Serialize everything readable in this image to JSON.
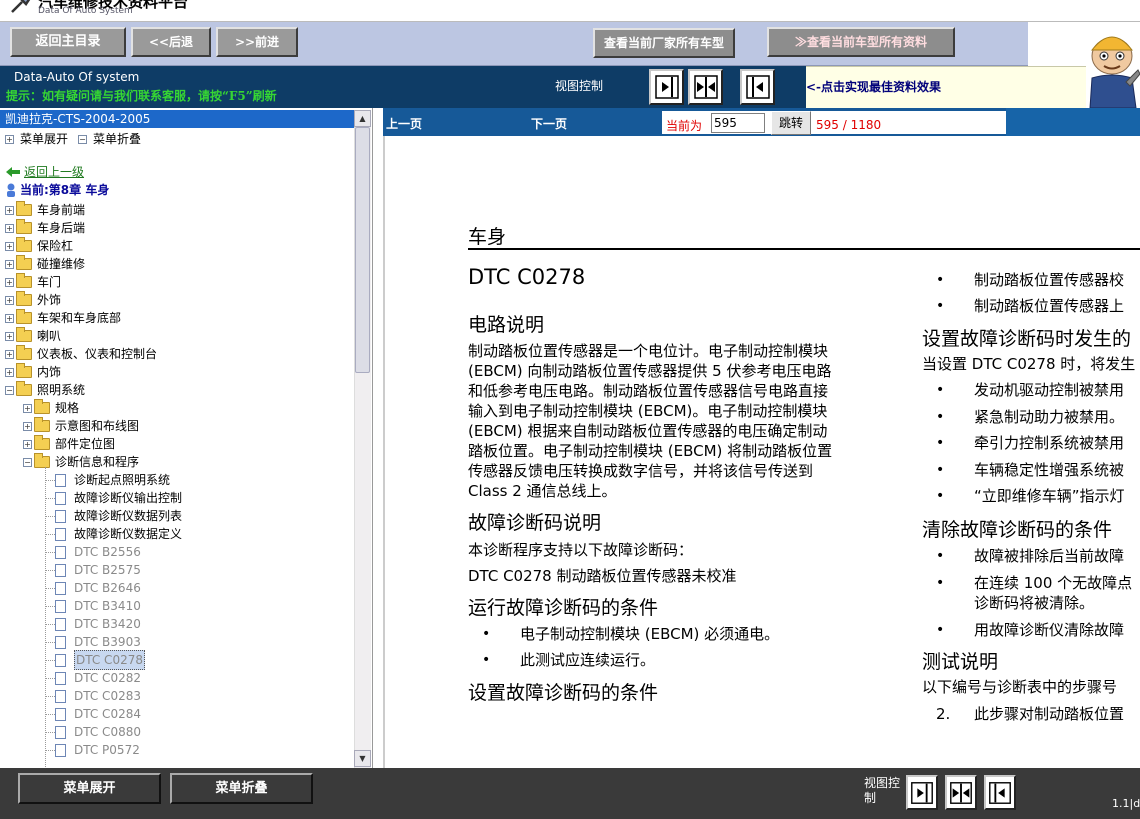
{
  "app": {
    "title": "汽车维修技术资料平台",
    "subtitle": "Data Of Auto System"
  },
  "toolbar": {
    "home": "返回主目录",
    "back": "<<后退",
    "forward": ">>前进",
    "all_makes": "查看当前厂家所有车型",
    "all_data": "≫查看当前车型所有资料"
  },
  "status_row": {
    "system_name": "Data-Auto Of system",
    "notice": "提示：如有疑问请与我们联系客服，请按“F5”刷新",
    "view_label": "视图控制",
    "hint": "<-点击实现最佳资料效果"
  },
  "tree": {
    "header": "凯迪拉克-CTS-2004-2005",
    "expand_all": "菜单展开",
    "collapse_all": "菜单折叠",
    "back_up": "返回上一级",
    "current": "当前:第8章  车身",
    "folders": [
      {
        "label": "车身前端"
      },
      {
        "label": "车身后端"
      },
      {
        "label": "保险杠"
      },
      {
        "label": "碰撞维修"
      },
      {
        "label": "车门"
      },
      {
        "label": "外饰"
      },
      {
        "label": "车架和车身底部"
      },
      {
        "label": "喇叭"
      },
      {
        "label": "仪表板、仪表和控制台"
      },
      {
        "label": "内饰"
      },
      {
        "label": "照明系统"
      }
    ],
    "subfolders": [
      {
        "label": "规格"
      },
      {
        "label": "示意图和布线图"
      },
      {
        "label": "部件定位图"
      },
      {
        "label": "诊断信息和程序"
      }
    ],
    "leaves": [
      {
        "label": "诊断起点照明系统"
      },
      {
        "label": "故障诊断仪输出控制"
      },
      {
        "label": "故障诊断仪数据列表"
      },
      {
        "label": "故障诊断仪数据定义"
      },
      {
        "label": "DTC B2556"
      },
      {
        "label": "DTC B2575"
      },
      {
        "label": "DTC B2646"
      },
      {
        "label": "DTC B3410"
      },
      {
        "label": "DTC B3420"
      },
      {
        "label": "DTC B3903"
      },
      {
        "label": "DTC C0278"
      },
      {
        "label": "DTC C0282"
      },
      {
        "label": "DTC C0283"
      },
      {
        "label": "DTC C0284"
      },
      {
        "label": "DTC C0880"
      },
      {
        "label": "DTC P0572"
      }
    ],
    "selected_leaf": "DTC C0278"
  },
  "content_nav": {
    "prev": "上一页",
    "next": "下一页",
    "current_label": "当前为",
    "page_value": "595",
    "go": "跳转",
    "page_status": "595 / 1180"
  },
  "document": {
    "section": "车身",
    "dtc": "DTC C0278",
    "left": {
      "h_circuit": "电路说明",
      "circuit_lines": [
        "制动踏板位置传感器是一个电位计。电子制动控制模块",
        "(EBCM) 向制动踏板位置传感器提供 5 伏参考电压电路",
        "和低参考电压电路。制动踏板位置传感器信号电路直接",
        "输入到电子制动控制模块 (EBCM)。电子制动控制模块",
        "(EBCM) 根据来自制动踏板位置传感器的电压确定制动",
        "踏板位置。电子制动控制模块 (EBCM) 将制动踏板位置",
        "传感器反馈电压转换成数字信号，并将该信号传送到",
        "Class 2 通信总线上。"
      ],
      "h_dtc_desc": "故障诊断码说明",
      "dtc_desc_1": "本诊断程序支持以下故障诊断码：",
      "dtc_desc_2": "DTC C0278 制动踏板位置传感器未校准",
      "h_run": "运行故障诊断码的条件",
      "run_items": [
        "电子制动控制模块 (EBCM) 必须通电。",
        "此测试应连续运行。"
      ],
      "h_set": "设置故障诊断码的条件"
    },
    "right": {
      "top_items": [
        "制动踏板位置传感器校",
        "制动踏板位置传感器上"
      ],
      "h_action": "设置故障诊断码时发生的",
      "action_intro": "当设置 DTC C0278 时，将发生",
      "action_items": [
        "发动机驱动控制被禁用",
        "紧急制动助力被禁用。",
        "牵引力控制系统被禁用",
        "车辆稳定性增强系统被",
        "“立即维修车辆”指示灯"
      ],
      "h_clear": "清除故障诊断码的条件",
      "clear_items": [
        "故障被排除后当前故障",
        "在连续 100 个无故障点",
        "诊断码将被清除。",
        "用故障诊断仪清除故障"
      ],
      "h_test": "测试说明",
      "test_intro": "以下编号与诊断表中的步骤号",
      "test_item_num": "2.",
      "test_item": "此步骤对制动踏板位置"
    }
  },
  "bottom": {
    "expand": "菜单展开",
    "collapse": "菜单折叠",
    "view_label": "视图控制",
    "version": "1.1|d"
  }
}
